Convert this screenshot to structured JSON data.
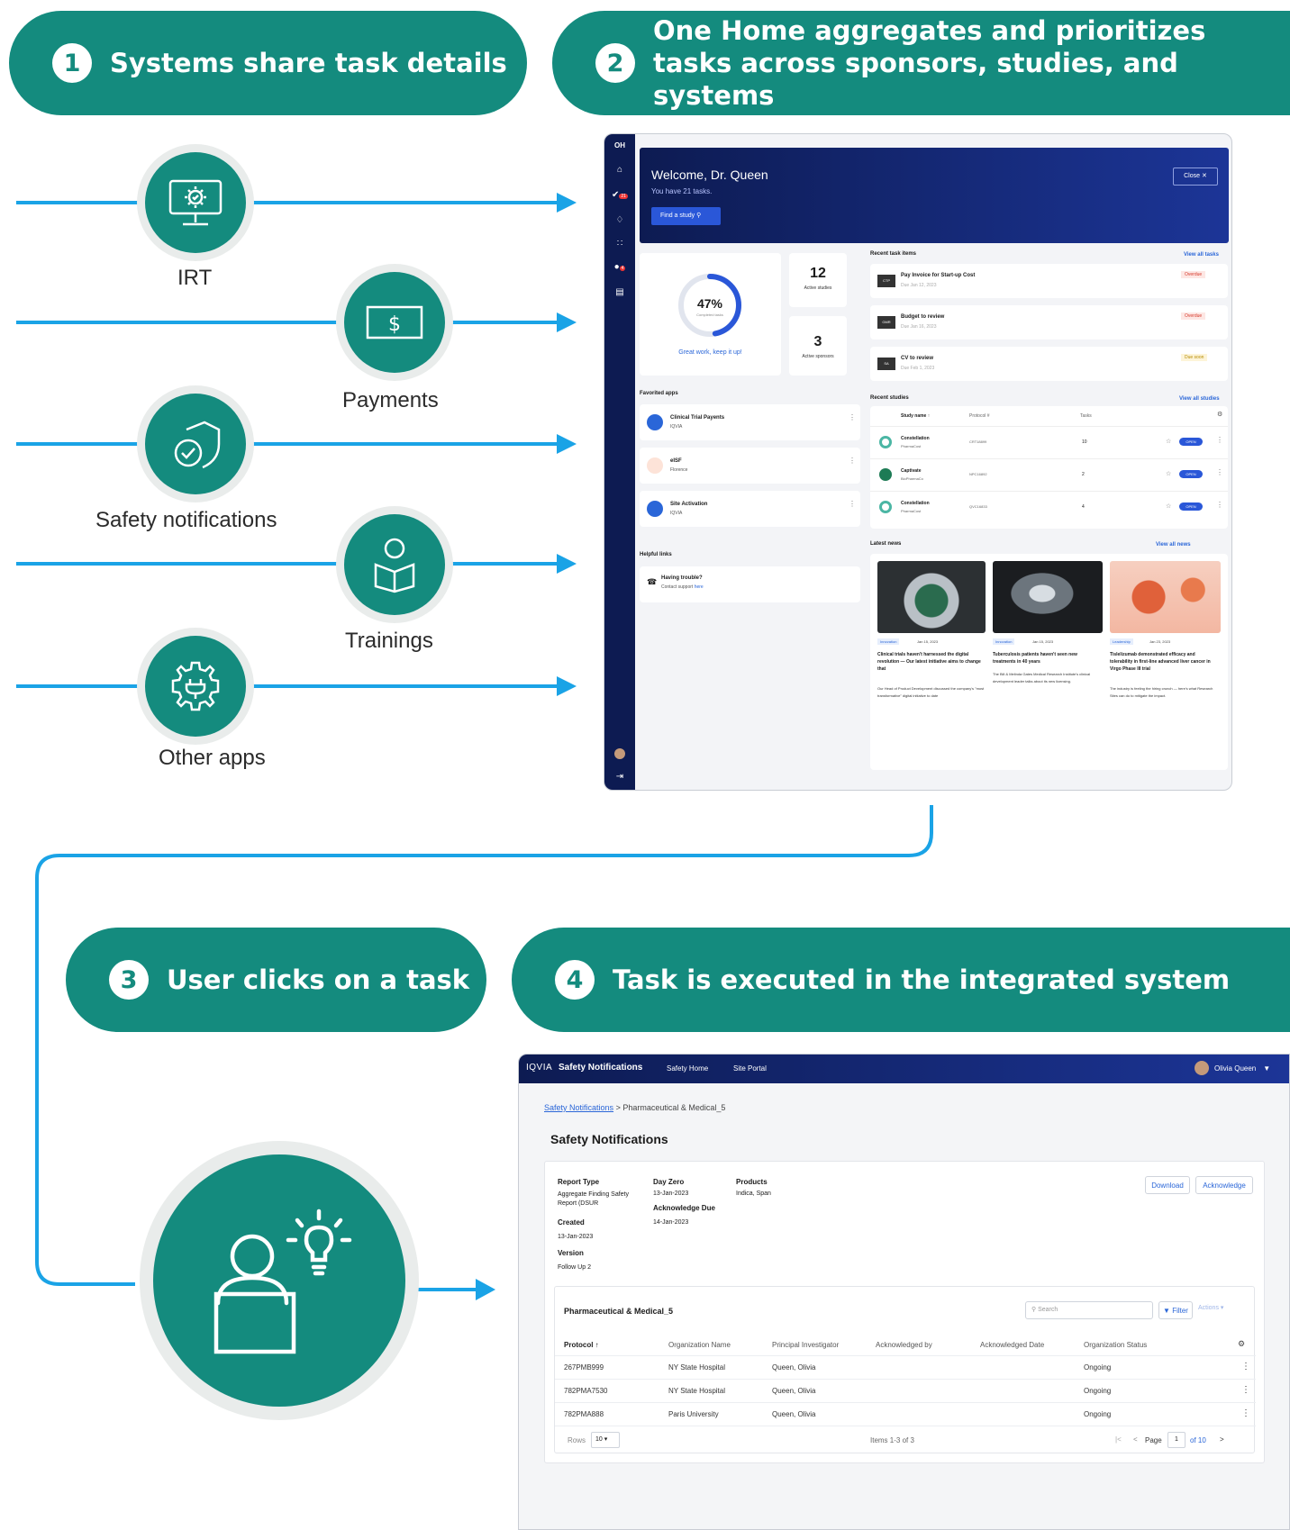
{
  "colors": {
    "teal": "#148b7e",
    "arrow": "#1aa3e6",
    "navy": "#0d1b52"
  },
  "steps": [
    {
      "num": "1",
      "label": "Systems share task details"
    },
    {
      "num": "2",
      "label": "One Home aggregates and prioritizes tasks across sponsors, studies, and systems"
    },
    {
      "num": "3",
      "label": "User clicks on a task"
    },
    {
      "num": "4",
      "label": "Task is executed in the integrated system"
    }
  ],
  "systems": [
    {
      "label": "IRT",
      "icon": "monitor-gear-icon"
    },
    {
      "label": "Payments",
      "icon": "dollar-bill-icon"
    },
    {
      "label": "Safety notifications",
      "icon": "shield-check-icon"
    },
    {
      "label": "Trainings",
      "icon": "person-book-icon"
    },
    {
      "label": "Other apps",
      "icon": "gear-plug-icon"
    }
  ],
  "user_icon": "user-laptop-lightbulb-icon",
  "dashboard": {
    "logo": "OH",
    "nav_badges": {
      "tasks": "21",
      "alerts": "4"
    },
    "welcome": "Welcome, Dr. Queen",
    "tasks_line": "You have 21 tasks.",
    "find_study": "Find a study",
    "close": "Close",
    "progress_pct": "47%",
    "progress_value": 47,
    "progress_sub": "Completed tasks",
    "progress_msg": "Great work, keep it up!",
    "active_studies_num": "12",
    "active_studies_label": "Active studies",
    "active_sponsors_num": "3",
    "active_sponsors_label": "Active sponsors",
    "recent_tasks_title": "Recent task items",
    "view_all_tasks": "View all tasks",
    "tasks": [
      {
        "code": "CTP",
        "title": "Pay Invoice for Start-up Cost",
        "due": "Due Jan 12, 2023",
        "status": "Overdue",
        "status_color": "#d6392b"
      },
      {
        "code": "GMR",
        "title": "Budget to review",
        "due": "Due Jan 16, 2023",
        "status": "Overdue",
        "status_color": "#d6392b"
      },
      {
        "code": "SA",
        "title": "CV to review",
        "due": "Due Feb 1, 2023",
        "status": "Due soon",
        "status_color": "#b68b00"
      }
    ],
    "fav_title": "Favorited apps",
    "fav_apps": [
      {
        "name": "Clinical Trial Payents",
        "org": "IQVIA"
      },
      {
        "name": "eISF",
        "org": "Florence"
      },
      {
        "name": "Site Activation",
        "org": "IQVIA"
      }
    ],
    "helpful_title": "Helpful links",
    "helpful_item": "Having trouble?",
    "helpful_sub": "Contact support",
    "helpful_link": "here",
    "studies_title": "Recent studies",
    "view_all_studies": "View all studies",
    "studies_headers": [
      "Study name",
      "Protocol #",
      "Tasks"
    ],
    "studies": [
      {
        "name": "Constellation",
        "sponsor": "PharmaCost",
        "protocol": "CRT18899",
        "tasks": "10",
        "btn": "OPEN"
      },
      {
        "name": "Captivate",
        "sponsor": "BioPharmaCo",
        "protocol": "NPC16892",
        "tasks": "2",
        "btn": "OPEN"
      },
      {
        "name": "Constellation",
        "sponsor": "PharmaCost",
        "protocol": "QVC16833",
        "tasks": "4",
        "btn": "OPEN"
      }
    ],
    "news_title": "Latest news",
    "view_all_news": "View all news",
    "news": [
      {
        "tag": "Innovation",
        "date": "Jan 15, 2023",
        "title": "Clinical trials haven't harnessed the digital revolution — Our latest initiative aims to change that",
        "body": "Our Head of Product Development discussed the company's \"most transformative\" digital initiative to date"
      },
      {
        "tag": "Innovation",
        "date": "Jan 15, 2023",
        "title": "Tuberculosis patients haven't seen new treatments in 40 years",
        "body": "The Bill & Melinda Gates Medical Research Institute's clinical development leader talks about its new licensing."
      },
      {
        "tag": "Leadership",
        "date": "Jan 23, 2023",
        "title": "Tislelizumab demonstrated efficacy and tolerability in first-line advanced liver cancer in Virgo Phase III trial",
        "body": "The industry is feeling the hiring crunch — here's what Research Sites can do to mitigate the impact."
      }
    ]
  },
  "safety": {
    "brand": "IQVIA",
    "app": "Safety Notifications",
    "nav": [
      "Safety Home",
      "Site Portal"
    ],
    "user": "Olivia Queen",
    "breadcrumb_link": "Safety Notifications",
    "breadcrumb_current": "Pharmaceutical & Medical_5",
    "page_title": "Safety Notifications",
    "report_type_label": "Report Type",
    "report_type": "Aggregate Finding Safety Report (DSUR",
    "created_label": "Created",
    "created": "13-Jan-2023",
    "version_label": "Version",
    "version": "Follow Up 2",
    "day_zero_label": "Day Zero",
    "day_zero": "13-Jan-2023",
    "ack_due_label": "Acknowledge Due",
    "ack_due": "14-Jan-2023",
    "products_label": "Products",
    "products": "Indica, Span",
    "download": "Download",
    "acknowledge": "Acknowledge",
    "table_title": "Pharmaceutical & Medical_5",
    "search_placeholder": "Search",
    "filter": "Filter",
    "actions": "Actions",
    "headers": [
      "Protocol",
      "Organization Name",
      "Principal Investigator",
      "Acknowledged by",
      "Acknowledged Date",
      "Organization Status"
    ],
    "rows": [
      {
        "protocol": "267PMB999",
        "org": "NY State Hospital",
        "pi": "Queen, Olivia",
        "ack_by": "",
        "ack_date": "",
        "status": "Ongoing"
      },
      {
        "protocol": "782PMA7530",
        "org": "NY State Hospital",
        "pi": "Queen, Olivia",
        "ack_by": "",
        "ack_date": "",
        "status": "Ongoing"
      },
      {
        "protocol": "782PMA888",
        "org": "Paris University",
        "pi": "Queen, Olivia",
        "ack_by": "",
        "ack_date": "",
        "status": "Ongoing"
      }
    ],
    "rows_label": "Rows",
    "rows_value": "10",
    "items_label": "Items 1-3 of 3",
    "page_label": "Page",
    "page_value": "1",
    "page_of": "of 10"
  }
}
